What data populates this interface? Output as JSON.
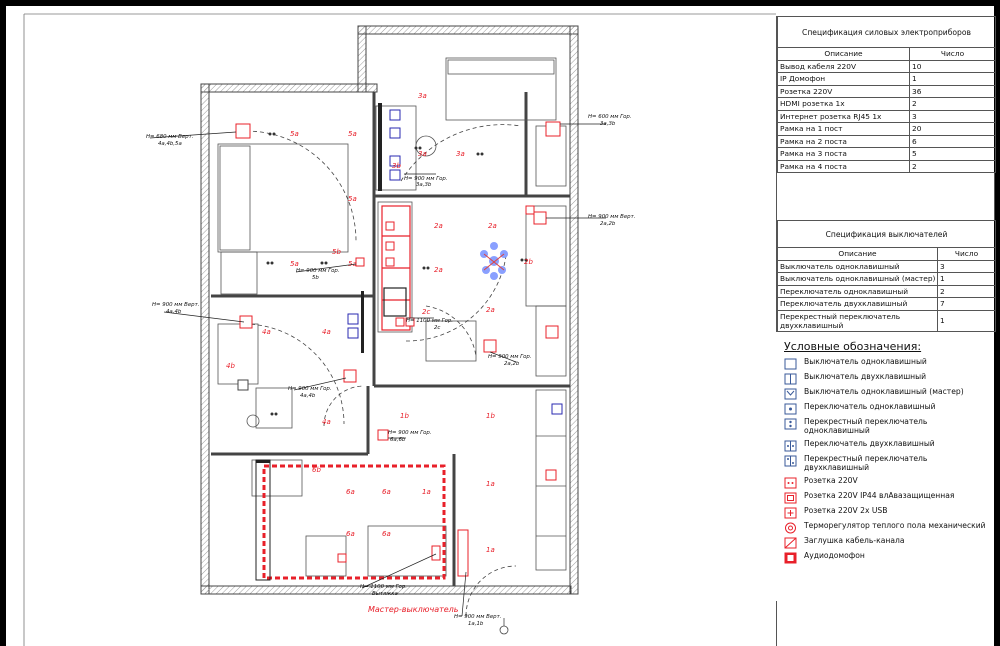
{
  "spec_power": {
    "title": "Спецификация силовых электроприборов",
    "col_desc": "Описание",
    "col_count": "Число",
    "rows": [
      {
        "desc": "Вывод кабеля 220V",
        "count": "10"
      },
      {
        "desc": "IP Домофон",
        "count": "1"
      },
      {
        "desc": "Розетка 220V",
        "count": "36"
      },
      {
        "desc": "HDMI розетка 1х",
        "count": "2"
      },
      {
        "desc": "Интернет розетка RJ45 1х",
        "count": "3"
      },
      {
        "desc": "Рамка на 1 пост",
        "count": "20"
      },
      {
        "desc": "Рамка на 2 поста",
        "count": "6"
      },
      {
        "desc": "Рамка на 3 поста",
        "count": "5"
      },
      {
        "desc": "Рамка на 4 поста",
        "count": "2"
      }
    ]
  },
  "spec_switch": {
    "title": "Спецификация выключателей",
    "col_desc": "Описание",
    "col_count": "Число",
    "rows": [
      {
        "desc": "Выключатель одноклавишный",
        "count": "3"
      },
      {
        "desc": "Выключатель одноклавишный (мастер)",
        "count": "1"
      },
      {
        "desc": "Переключатель одноклавишный",
        "count": "2"
      },
      {
        "desc": "Переключатель двухклавишный",
        "count": "7"
      },
      {
        "desc": "Перекрестный переключатель двухклавишный",
        "count": "1"
      }
    ]
  },
  "legend": {
    "title": "Условные обозначения:",
    "items": [
      {
        "icon": "switch-single-icon",
        "label": "Выключатель одноклавишный"
      },
      {
        "icon": "switch-double-icon",
        "label": "Выключатель двухклавишный"
      },
      {
        "icon": "switch-master-icon",
        "label": "Выключатель одноклавишный (мастер)"
      },
      {
        "icon": "toggle-single-icon",
        "label": "Переключатель одноклавишный"
      },
      {
        "icon": "cross-switch-single-icon",
        "label": "Перекрестный переключатель одноклавишный"
      },
      {
        "icon": "toggle-double-icon",
        "label": "Переключатель двухклавишный"
      },
      {
        "icon": "cross-switch-double-icon",
        "label": "Перекрестный переключатель двухклавишный"
      },
      {
        "icon": "socket-220-icon",
        "label": "Розетка 220V"
      },
      {
        "icon": "socket-ip44-icon",
        "label": "Розетка 220V IP44 влАвазащищенная"
      },
      {
        "icon": "socket-usb-icon",
        "label": "Розетка 220V 2x USB"
      },
      {
        "icon": "thermostat-icon",
        "label": "Терморегулятор теплого пола механический"
      },
      {
        "icon": "cable-cap-icon",
        "label": "Заглушка кабель-канала"
      },
      {
        "icon": "intercom-icon",
        "label": "Аудиодомофон"
      }
    ]
  },
  "plan": {
    "room_labels": [
      "5a",
      "5a",
      "5a",
      "5a",
      "5a",
      "4a",
      "4a",
      "4a",
      "3a",
      "3a",
      "3a",
      "2a",
      "2a",
      "2a",
      "2a",
      "2b",
      "1b",
      "1b",
      "1a",
      "1a",
      "1a",
      "6a",
      "6a",
      "6a",
      "6a",
      "6b",
      "4b",
      "5b",
      "3b",
      "2c"
    ],
    "callouts": [
      {
        "line1": "H= 680 мм Верт.",
        "line2": "4a,4b,5a"
      },
      {
        "line1": "H= 900 мм Гор.",
        "line2": "3a,3b"
      },
      {
        "line1": "H= 600 мм Гор.",
        "line2": "3a,3b"
      },
      {
        "line1": "H= 900 мм Верт.",
        "line2": "2a,2b"
      },
      {
        "line1": "H= 900 мм Гор.",
        "line2": "5b"
      },
      {
        "line1": "H= 900 мм Верт.",
        "line2": "4a,4b"
      },
      {
        "line1": "H= 1100 мм Гор.",
        "line2": "2c"
      },
      {
        "line1": "H= 900 мм Гор.",
        "line2": "2a,2b"
      },
      {
        "line1": "H= 900 мм Гор.",
        "line2": "4a,4b"
      },
      {
        "line1": "H= 900 мм Гор.",
        "line2": "6a,6b"
      },
      {
        "line1": "H= 1100 мм Гор.",
        "line2": "Вытяжка"
      },
      {
        "line1": "H= 900 мм Верт.",
        "line2": "1a,1b"
      }
    ],
    "master_label": "Мастер-выключатель",
    "colors": {
      "wall": "#444444",
      "red": "#e8202a",
      "blue": "#2a2ab0",
      "hatch": "#9a9a9a"
    }
  }
}
